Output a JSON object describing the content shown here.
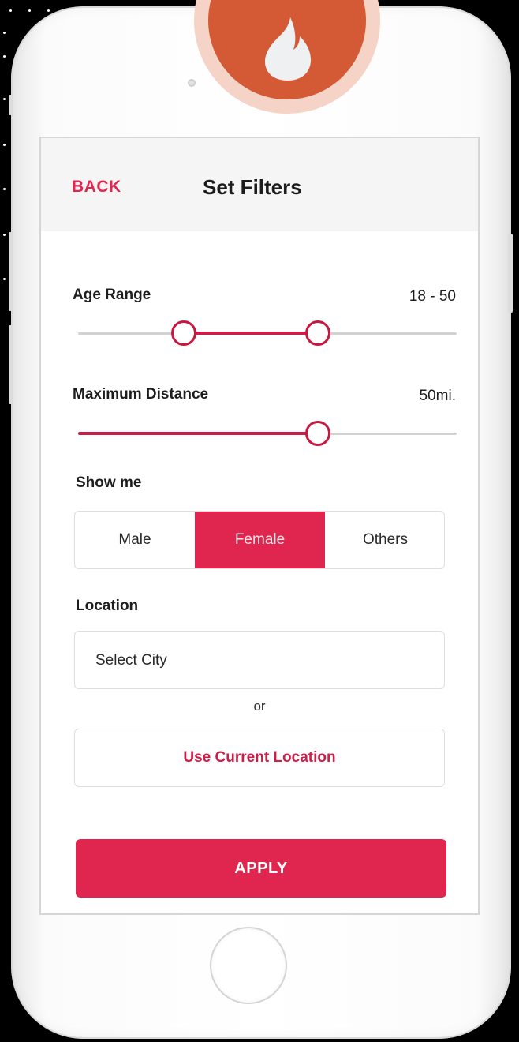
{
  "colors": {
    "accent": "#e0264e",
    "brand_logo": "#d35a35",
    "logo_ring": "#f5d3c6"
  },
  "icons": {
    "logo": "flame-icon"
  },
  "header": {
    "back_label": "BACK",
    "title": "Set Filters"
  },
  "age_range": {
    "label": "Age Range",
    "value_text": "18 - 50"
  },
  "max_distance": {
    "label": "Maximum Distance",
    "value_text": "50mi."
  },
  "show_me": {
    "label": "Show me",
    "options": [
      "Male",
      "Female",
      "Others"
    ],
    "selected": "Female"
  },
  "location": {
    "label": "Location",
    "city_placeholder": "Select City",
    "or_text": "or",
    "current_location_label": "Use Current Location"
  },
  "apply_label": "APPLY"
}
